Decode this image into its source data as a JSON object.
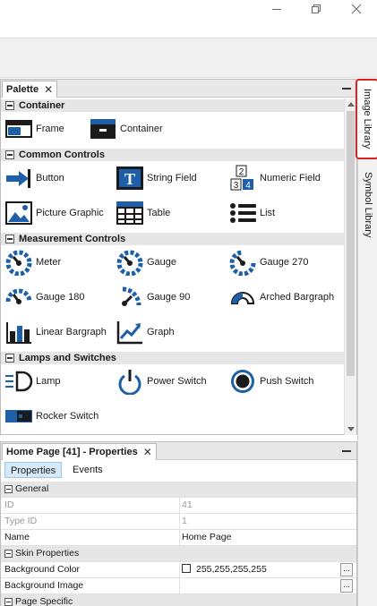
{
  "window": {
    "controls": [
      "minimize-icon",
      "restore-icon",
      "close-icon"
    ]
  },
  "palette": {
    "tab_label": "Palette",
    "categories": [
      {
        "label": "Container",
        "items": [
          {
            "label": "Frame",
            "icon": "frame-icon"
          },
          {
            "label": "Container",
            "icon": "container-icon"
          }
        ]
      },
      {
        "label": "Common Controls",
        "items": [
          {
            "label": "Button",
            "icon": "button-icon"
          },
          {
            "label": "String Field",
            "icon": "string-field-icon"
          },
          {
            "label": "Numeric Field",
            "icon": "numeric-field-icon"
          },
          {
            "label": "Picture Graphic",
            "icon": "picture-graphic-icon"
          },
          {
            "label": "Table",
            "icon": "table-icon"
          },
          {
            "label": "List",
            "icon": "list-icon"
          }
        ]
      },
      {
        "label": "Measurement Controls",
        "items": [
          {
            "label": "Meter",
            "icon": "meter-icon"
          },
          {
            "label": "Gauge",
            "icon": "gauge-icon"
          },
          {
            "label": "Gauge 270",
            "icon": "gauge-270-icon"
          },
          {
            "label": "Gauge 180",
            "icon": "gauge-180-icon"
          },
          {
            "label": "Gauge 90",
            "icon": "gauge-90-icon"
          },
          {
            "label": "Arched Bargraph",
            "icon": "arched-bargraph-icon"
          },
          {
            "label": "Linear Bargraph",
            "icon": "linear-bargraph-icon"
          },
          {
            "label": "Graph",
            "icon": "graph-icon"
          }
        ]
      },
      {
        "label": "Lamps and Switches",
        "items": [
          {
            "label": "Lamp",
            "icon": "lamp-icon"
          },
          {
            "label": "Power Switch",
            "icon": "power-switch-icon"
          },
          {
            "label": "Push Switch",
            "icon": "push-switch-icon"
          },
          {
            "label": "Rocker Switch",
            "icon": "rocker-switch-icon"
          }
        ]
      }
    ],
    "numeric_icon_digits": [
      "2",
      "3",
      "4"
    ]
  },
  "sidebar": {
    "tabs": [
      "Image Library",
      "Symbol Library"
    ]
  },
  "properties": {
    "tab_label": "Home Page [41] - Properties",
    "subtabs": [
      "Properties",
      "Events"
    ],
    "rows": [
      {
        "type": "section",
        "label": "General"
      },
      {
        "type": "prop",
        "label": "ID",
        "value": "41",
        "dim": true
      },
      {
        "type": "prop",
        "label": "Type ID",
        "value": "1",
        "dim": true
      },
      {
        "type": "prop",
        "label": "Name",
        "value": "Home Page"
      },
      {
        "type": "section",
        "label": "Skin Properties"
      },
      {
        "type": "prop",
        "label": "Background Color",
        "value": "255,255,255,255",
        "swatch": "#ffffff",
        "ellipsis": "..."
      },
      {
        "type": "prop",
        "label": "Background Image",
        "value": "",
        "ellipsis": "..."
      },
      {
        "type": "section",
        "label": "Page Specific"
      }
    ]
  },
  "colors": {
    "icon_blue": "#1d5fa8",
    "icon_dark": "#1b1b1b",
    "highlight_red": "#e02020",
    "selected_subtab": "#d6e9f8"
  }
}
